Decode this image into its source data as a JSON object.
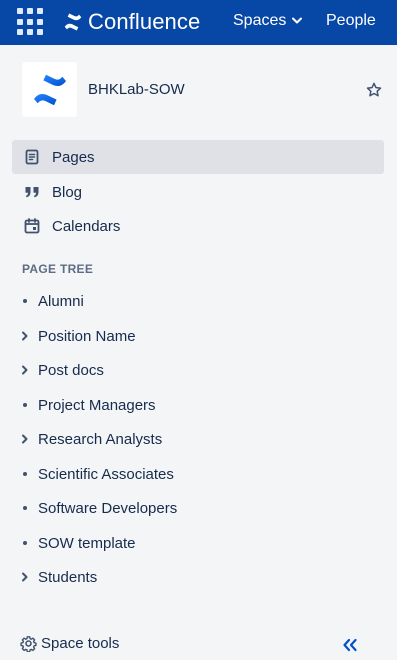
{
  "topbar": {
    "product_name": "Confluence",
    "spaces_label": "Spaces",
    "people_label": "People",
    "icons": [
      "app-switcher-icon",
      "confluence-logo-icon",
      "chevron-down-icon"
    ]
  },
  "space": {
    "name": "BHKLab-SOW",
    "icons": [
      "space-avatar-icon",
      "star-icon"
    ]
  },
  "main_nav": [
    {
      "label": "Pages",
      "icon": "pages-icon",
      "active": true
    },
    {
      "label": "Blog",
      "icon": "quote-icon",
      "active": false
    },
    {
      "label": "Calendars",
      "icon": "calendar-icon",
      "active": false
    }
  ],
  "page_tree": {
    "label": "PAGE TREE",
    "items": [
      {
        "label": "Alumni",
        "expandable": false
      },
      {
        "label": "Position Name",
        "expandable": true
      },
      {
        "label": "Post docs",
        "expandable": true
      },
      {
        "label": "Project Managers",
        "expandable": false
      },
      {
        "label": "Research Analysts",
        "expandable": true
      },
      {
        "label": "Scientific Associates",
        "expandable": false
      },
      {
        "label": "Software Developers",
        "expandable": false
      },
      {
        "label": "SOW template",
        "expandable": false
      },
      {
        "label": "Students",
        "expandable": true
      }
    ]
  },
  "footer": {
    "space_tools_label": "Space tools",
    "icons": [
      "gear-icon",
      "collapse-sidebar-icon"
    ]
  },
  "colors": {
    "topbar": "#0747a6",
    "sidebar_bg": "#f4f5f7",
    "active_item": "#dfe1e6",
    "text": "#172b4d",
    "link_blue": "#0052cc"
  }
}
